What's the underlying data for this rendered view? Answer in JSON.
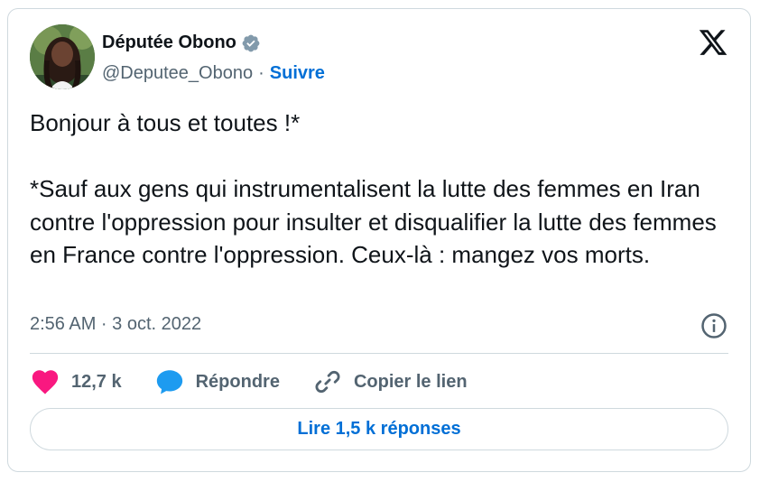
{
  "author": {
    "name": "Députée Obono",
    "handle": "@Deputee_Obono",
    "separator": "·",
    "follow_label": "Suivre"
  },
  "tweet": {
    "text": "Bonjour à tous et toutes !*\n\n*Sauf aux gens qui instrumentalisent la lutte des femmes en Iran contre l'oppression pour insulter et disqualifier la lutte des femmes en France contre l'oppression. Ceux-là : mangez vos morts.",
    "timestamp": "2:56 AM · 3 oct. 2022"
  },
  "actions": {
    "likes": "12,7 k",
    "reply_label": "Répondre",
    "copy_link_label": "Copier le lien"
  },
  "read_replies_label": "Lire 1,5 k réponses",
  "icons": {
    "verified": "verified-badge-icon",
    "logo": "x-logo-icon",
    "info": "info-icon",
    "like": "heart-icon",
    "reply": "speech-bubble-icon",
    "copy": "link-icon"
  },
  "colors": {
    "accent": "#006fd6",
    "like": "#f91880",
    "reply": "#1d9bf0",
    "muted": "#536471",
    "border": "#cfd9de"
  }
}
